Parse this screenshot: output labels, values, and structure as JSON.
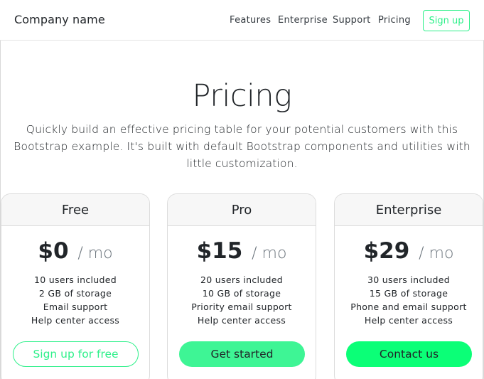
{
  "header": {
    "brand": "Company name",
    "nav": [
      "Features",
      "Enterprise",
      "Support",
      "Pricing"
    ],
    "signup_label": "Sign up"
  },
  "hero": {
    "title": "Pricing",
    "lead": "Quickly build an effective pricing table for your potential customers with this Bootstrap example. It's built with default Bootstrap components and utilities with little customization."
  },
  "plans": [
    {
      "name": "Free",
      "price": "$0",
      "per": "/ mo",
      "features": [
        "10 users included",
        "2 GB of storage",
        "Email support",
        "Help center access"
      ],
      "button": "Sign up for free"
    },
    {
      "name": "Pro",
      "price": "$15",
      "per": "/ mo",
      "features": [
        "20 users included",
        "10 GB of storage",
        "Priority email support",
        "Help center access"
      ],
      "button": "Get started"
    },
    {
      "name": "Enterprise",
      "price": "$29",
      "per": "/ mo",
      "features": [
        "30 users included",
        "15 GB of storage",
        "Phone and email support",
        "Help center access"
      ],
      "button": "Contact us"
    }
  ],
  "colors": {
    "accent": "#2ef08a",
    "accent_fill": "#0bff77",
    "card_header_bg": "#f7f7f7",
    "muted": "#6c757d"
  }
}
